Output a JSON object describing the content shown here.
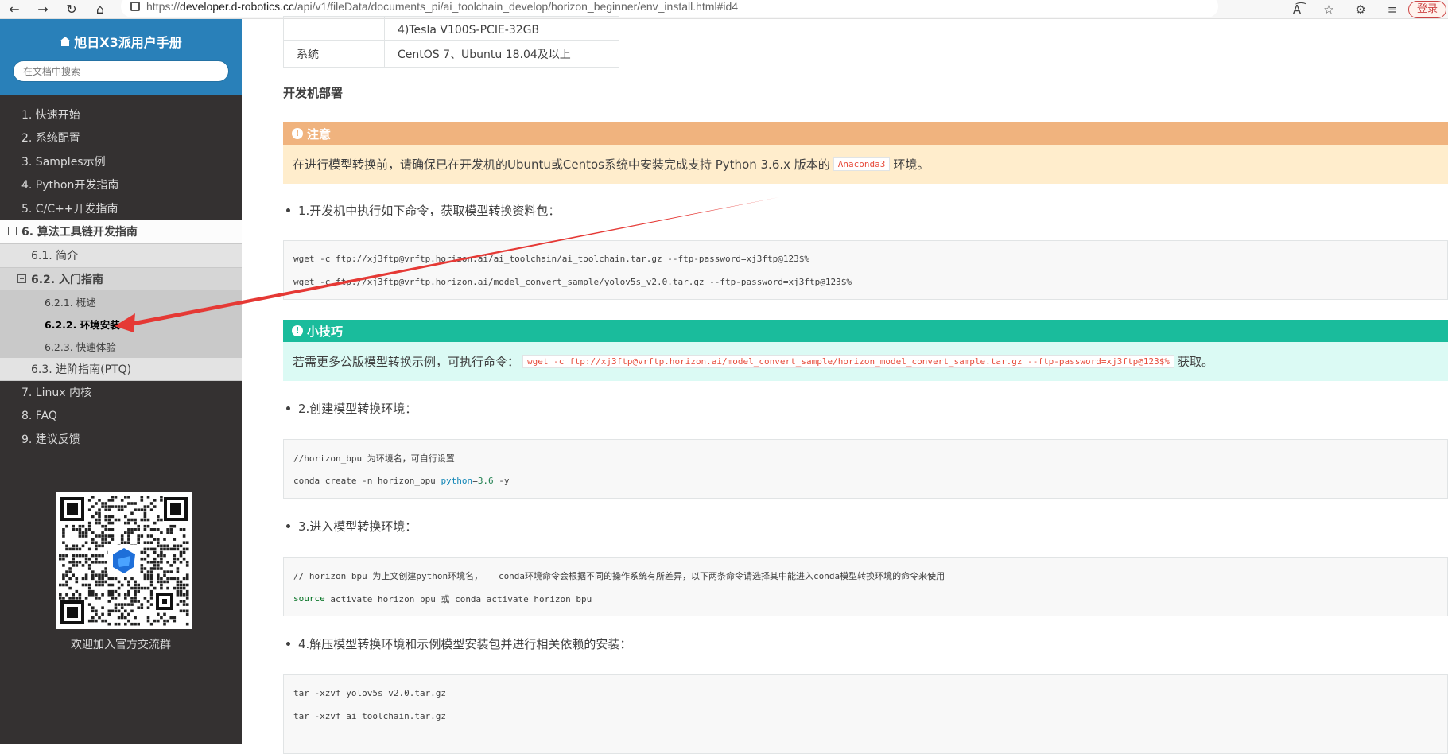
{
  "browser": {
    "url_prefix": "https://",
    "url_host": "developer.d-robotics.cc",
    "url_path": "/api/v1/fileData/documents_pi/ai_toolchain_develop/horizon_beginner/env_install.html#id4",
    "login_label": "登录"
  },
  "sidebar": {
    "title": "旭日X3派用户手册",
    "search_placeholder": "在文档中搜索",
    "items": [
      {
        "label": "1. 快速开始"
      },
      {
        "label": "2. 系统配置"
      },
      {
        "label": "3. Samples示例"
      },
      {
        "label": "4. Python开发指南"
      },
      {
        "label": "5. C/C++开发指南"
      },
      {
        "label": "6. 算法工具链开发指南"
      },
      {
        "label": "6.1. 简介"
      },
      {
        "label": "6.2. 入门指南"
      },
      {
        "label": "6.2.1. 概述"
      },
      {
        "label": "6.2.2. 环境安装"
      },
      {
        "label": "6.2.3. 快速体验"
      },
      {
        "label": "6.3. 进阶指南(PTQ)"
      },
      {
        "label": "7. Linux 内核"
      },
      {
        "label": "8. FAQ"
      },
      {
        "label": "9. 建议反馈"
      }
    ],
    "qr_caption": "欢迎加入官方交流群"
  },
  "main": {
    "table": {
      "row1_value": "4)Tesla V100S-PCIE-32GB",
      "row2_label": "系统",
      "row2_value": "CentOS 7、Ubuntu 18.04及以上"
    },
    "deploy_heading": "开发机部署",
    "warning": {
      "title": "注意",
      "text_before": "在进行模型转换前，请确保已在开发机的Ubuntu或Centos系统中安装完成支持 Python 3.6.x 版本的",
      "code": "Anaconda3",
      "text_after": "环境。"
    },
    "step1": "1.开发机中执行如下命令，获取模型转换资料包：",
    "code1": [
      "wget -c ftp://xj3ftp@vrftp.horizon.ai/ai_toolchain/ai_toolchain.tar.gz --ftp-password=xj3ftp@123$%",
      "wget -c ftp://xj3ftp@vrftp.horizon.ai/model_convert_sample/yolov5s_v2.0.tar.gz --ftp-password=xj3ftp@123$%"
    ],
    "tip": {
      "title": "小技巧",
      "text_before": "若需更多公版模型转换示例，可执行命令：",
      "code": "wget -c ftp://xj3ftp@vrftp.horizon.ai/model_convert_sample/horizon_model_convert_sample.tar.gz --ftp-password=xj3ftp@123$%",
      "text_after": "获取。"
    },
    "step2": "2.创建模型转换环境：",
    "code2": {
      "comment": "//horizon_bpu 为环境名，可自行设置",
      "cmd_prefix": "conda create -n horizon_bpu ",
      "cmd_kw": "python",
      "cmd_eq": "=",
      "cmd_num": "3.6",
      "cmd_suffix": " -y"
    },
    "step3": "3.进入模型转换环境：",
    "code3": {
      "comment": "// horizon_bpu 为上文创建python环境名，   conda环境命令会根据不同的操作系统有所差异，以下两条命令请选择其中能进入conda模型转换环境的命令来使用",
      "cmd_kw": "source",
      "cmd_rest": " activate horizon_bpu 或 conda activate horizon_bpu"
    },
    "step4": "4.解压模型转换环境和示例模型安装包并进行相关依赖的安装：",
    "code4": [
      "tar -xzvf yolov5s_v2.0.tar.gz",
      "tar -xzvf ai_toolchain.tar.gz"
    ]
  },
  "colors": {
    "sidebar_bg": "#343131",
    "sidebar_head": "#2980b9",
    "warning": "#f0b37e",
    "tip": "#1abc9c",
    "annotation_arrow": "#e53935"
  }
}
